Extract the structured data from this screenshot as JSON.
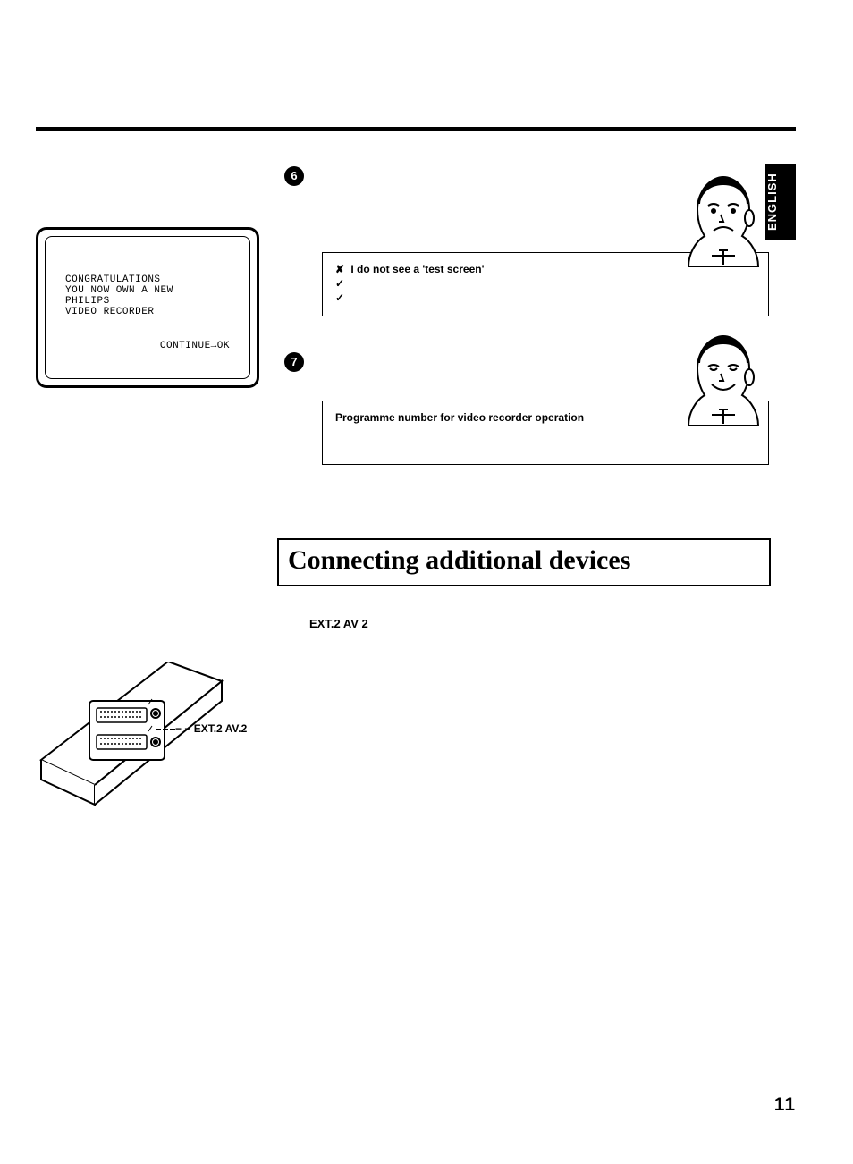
{
  "language_tab": "ENGLISH",
  "steps": {
    "six": {
      "num": "6"
    },
    "seven": {
      "num": "7"
    }
  },
  "tv_screen": {
    "line1": "CONGRATULATIONS",
    "line2": "YOU NOW OWN A NEW",
    "line3": "PHILIPS",
    "line4": "VIDEO RECORDER",
    "continue": "CONTINUE→OK"
  },
  "callout6": {
    "cross": "✘",
    "cross_text": " I do not see a 'test screen'",
    "check": "✓",
    "check2": "✓"
  },
  "callout7": {
    "title": "Programme number for video recorder operation"
  },
  "section_heading": "Connecting additional devices",
  "ext_label_inline": "EXT.2 AV 2",
  "connector_label_prefix": "− −",
  "connector_label": "EXT.2 AV.2",
  "page_number": "11"
}
